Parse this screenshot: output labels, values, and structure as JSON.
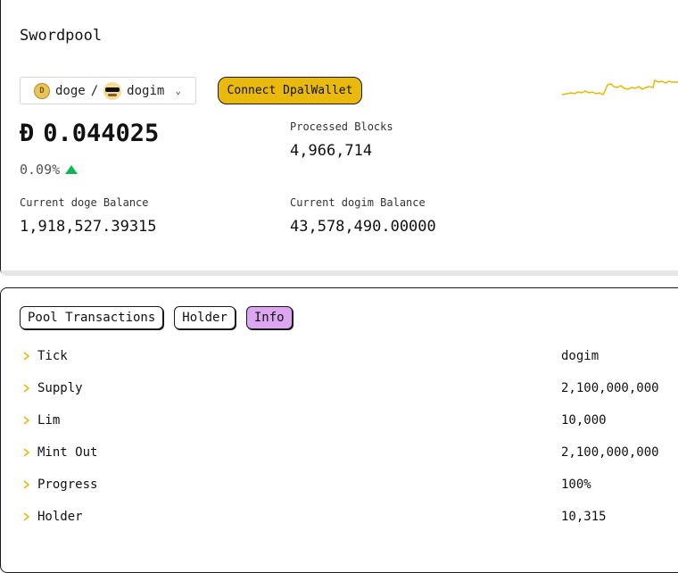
{
  "app": {
    "title": "Swordpool"
  },
  "pair_selector": {
    "base": "doge",
    "separator": "/",
    "quote": "dogim"
  },
  "connect_button": {
    "label": "Connect DpalWallet"
  },
  "colors": {
    "accent": "#e9b90e",
    "active_tab": "#dca7f0",
    "up": "#12b35a",
    "sparkline": "#e6b800"
  },
  "price": {
    "symbol": "Đ",
    "value": "0.044025",
    "change": "0.09%",
    "direction": "up"
  },
  "stats": {
    "processed_blocks_label": "Processed Blocks",
    "processed_blocks_value": "4,966,714",
    "doge_balance_label": "Current doge Balance",
    "doge_balance_value": "1,918,527.39315",
    "dogim_balance_label": "Current dogim Balance",
    "dogim_balance_value": "43,578,490.00000"
  },
  "tabs": [
    {
      "label": "Pool Transactions",
      "active": false
    },
    {
      "label": "Holder",
      "active": false
    },
    {
      "label": "Info",
      "active": true
    }
  ],
  "info_rows": [
    {
      "key": "Tick",
      "value": "dogim"
    },
    {
      "key": "Supply",
      "value": "2,100,000,000"
    },
    {
      "key": "Lim",
      "value": "10,000"
    },
    {
      "key": "Mint Out",
      "value": "2,100,000,000"
    },
    {
      "key": "Progress",
      "value": "100%"
    },
    {
      "key": "Holder",
      "value": "10,315"
    }
  ],
  "icons": {
    "expand": "chevron-right-icon",
    "dropdown": "chevron-down-icon"
  }
}
